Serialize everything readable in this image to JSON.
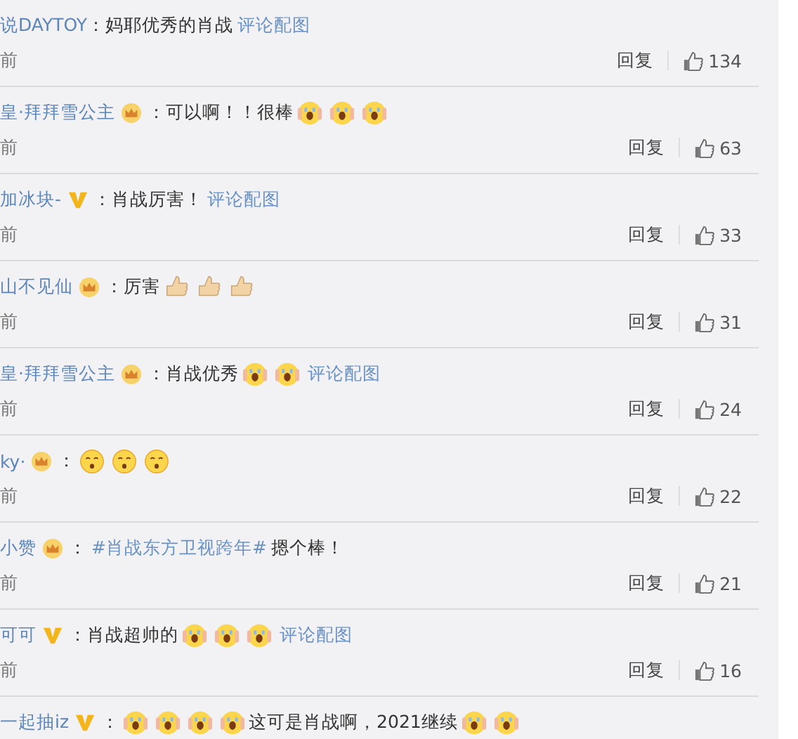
{
  "comments": [
    {
      "user": "说DAYTOY",
      "body": [
        {
          "kind": "text",
          "text": " ：妈耶优秀的肖战"
        },
        {
          "kind": "link",
          "text": "评论配图"
        }
      ],
      "time": "前",
      "reply": "回复",
      "likes": "134"
    },
    {
      "user": "皇·拜拜雪公主",
      "badge": {
        "kind": "crown"
      },
      "body": [
        {
          "kind": "text",
          "text": "：可以啊！！很棒"
        },
        {
          "kind": "scream"
        },
        {
          "kind": "scream"
        },
        {
          "kind": "scream"
        }
      ],
      "time": "前",
      "reply": "回复",
      "likes": "63"
    },
    {
      "user": "加冰块-",
      "badge": {
        "kind": "vip"
      },
      "body": [
        {
          "kind": "text",
          "text": "：肖战厉害！"
        },
        {
          "kind": "link",
          "text": "评论配图"
        }
      ],
      "time": "前",
      "reply": "回复",
      "likes": "33"
    },
    {
      "user": "山不见仙",
      "badge": {
        "kind": "crown"
      },
      "body": [
        {
          "kind": "text",
          "text": "：厉害"
        },
        {
          "kind": "thumbs"
        },
        {
          "kind": "thumbs"
        },
        {
          "kind": "thumbs"
        }
      ],
      "time": "前",
      "reply": "回复",
      "likes": "31"
    },
    {
      "user": "皇·拜拜雪公主",
      "badge": {
        "kind": "crown"
      },
      "body": [
        {
          "kind": "text",
          "text": "：肖战优秀"
        },
        {
          "kind": "scream"
        },
        {
          "kind": "scream"
        },
        {
          "kind": "link",
          "text": "评论配图"
        }
      ],
      "time": "前",
      "reply": "回复",
      "likes": "24"
    },
    {
      "user": "ky·",
      "badge": {
        "kind": "crown"
      },
      "body": [
        {
          "kind": "text",
          "text": "："
        },
        {
          "kind": "flushed"
        },
        {
          "kind": "flushed"
        },
        {
          "kind": "flushed"
        }
      ],
      "time": "前",
      "reply": "回复",
      "likes": "22"
    },
    {
      "user": "小赞",
      "badge": {
        "kind": "crown"
      },
      "body": [
        {
          "kind": "text",
          "text": "："
        },
        {
          "kind": "hashtag",
          "text": "#肖战东方卫视跨年#"
        },
        {
          "kind": "text",
          "text": "摁个棒！"
        }
      ],
      "time": "前",
      "reply": "回复",
      "likes": "21"
    },
    {
      "user": "可可",
      "badge": {
        "kind": "vip"
      },
      "body": [
        {
          "kind": "text",
          "text": "：肖战超帅的"
        },
        {
          "kind": "scream"
        },
        {
          "kind": "scream"
        },
        {
          "kind": "scream"
        },
        {
          "kind": "link",
          "text": "评论配图"
        }
      ],
      "time": "前",
      "reply": "回复",
      "likes": "16"
    },
    {
      "user": "一起抽iz",
      "badge": {
        "kind": "vip"
      },
      "body": [
        {
          "kind": "text",
          "text": "："
        },
        {
          "kind": "scream"
        },
        {
          "kind": "scream"
        },
        {
          "kind": "scream"
        },
        {
          "kind": "scream"
        },
        {
          "kind": "text",
          "text": "这可是肖战啊，2021继续"
        },
        {
          "kind": "scream"
        },
        {
          "kind": "scream"
        }
      ]
    }
  ]
}
